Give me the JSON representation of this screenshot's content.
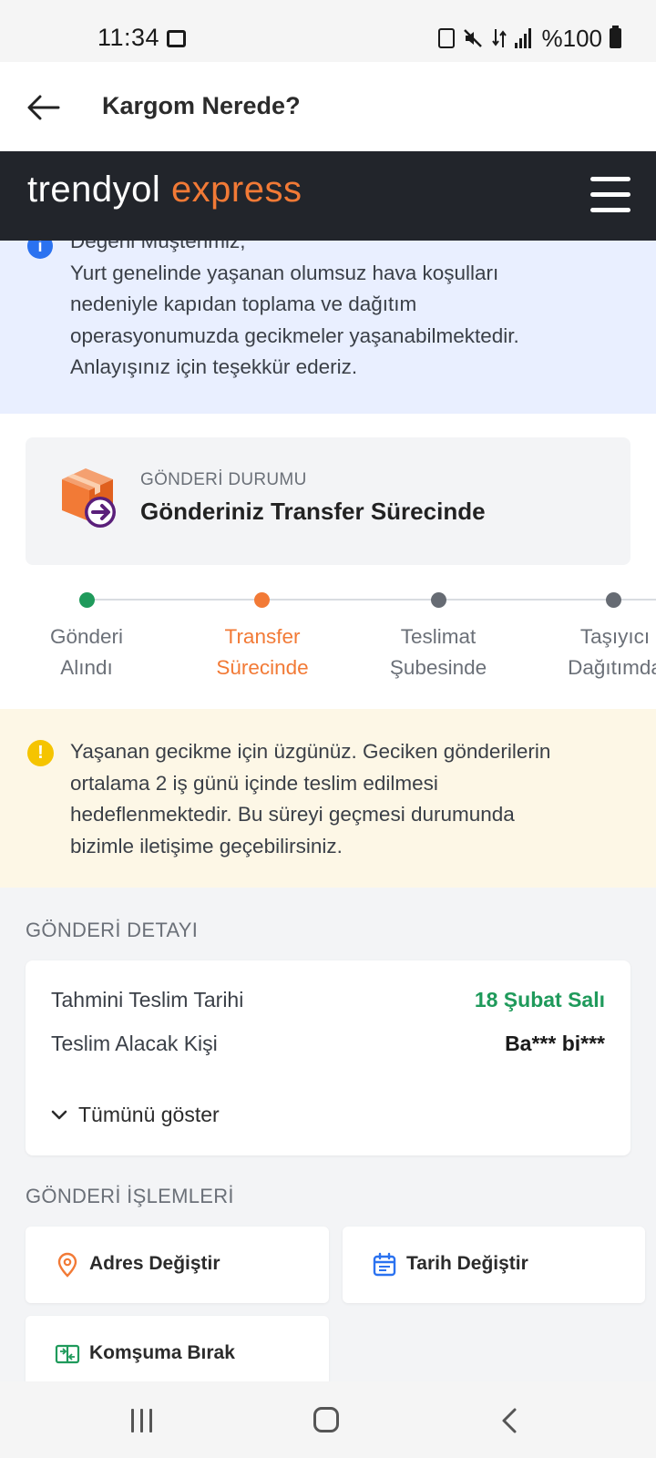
{
  "status_bar": {
    "time": "11:34",
    "battery": "%100"
  },
  "header": {
    "title": "Kargom Nerede?"
  },
  "brand": {
    "part1": "trendyol",
    "part2": "express"
  },
  "info_banner": {
    "text": "Değerli Müşterimiz,\nYurt genelinde yaşanan olumsuz hava koşulları\nnedeniyle kapıdan toplama ve dağıtım\noperasyonumuzda gecikmeler yaşanabilmektedir.\nAnlayışınız için teşekkür ederiz."
  },
  "shipment_status": {
    "label": "GÖNDERİ DURUMU",
    "value": "Gönderiniz Transfer Sürecinde"
  },
  "timeline": {
    "steps": [
      {
        "label": "Gönderi\nAlındı",
        "state": "done"
      },
      {
        "label": "Transfer\nSürecinde",
        "state": "active"
      },
      {
        "label": "Teslimat\nŞubesinde",
        "state": "pending"
      },
      {
        "label": "Taşıyıcı\nDağıtımda",
        "state": "pending"
      }
    ]
  },
  "warning_banner": {
    "text": "Yaşanan gecikme için üzgünüz. Geciken gönderilerin\nortalama 2 iş günü içinde teslim edilmesi\nhedeflenmektedir. Bu süreyi geçmesi durumunda\nbizimle iletişime geçebilirsiniz."
  },
  "details": {
    "title": "GÖNDERİ DETAYI",
    "rows": [
      {
        "label": "Tahmini Teslim Tarihi",
        "value": "18 Şubat Salı"
      },
      {
        "label": "Teslim Alacak Kişi",
        "value": "Ba*** bi***"
      }
    ],
    "show_all": "Tümünü göster"
  },
  "actions": {
    "title": "GÖNDERİ İŞLEMLERİ",
    "change_address": "Adres Değiştir",
    "change_date": "Tarih Değiştir",
    "leave_neighbor": "Komşuma Bırak"
  },
  "colors": {
    "brand_orange": "#f27a36",
    "dark_bar": "#22252b",
    "success_green": "#1f9a5b",
    "info_blue": "#2b72f0",
    "warning_yellow": "#f5c400"
  }
}
